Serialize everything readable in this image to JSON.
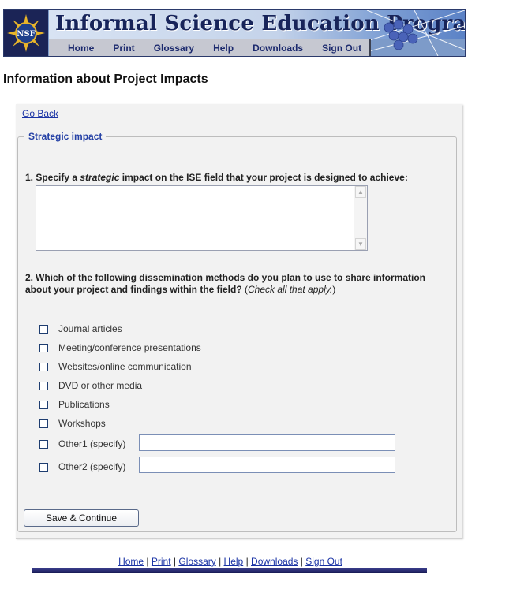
{
  "banner": {
    "title": "Informal Science Education Program",
    "logo_text": "NSF",
    "nav": [
      "Home",
      "Print",
      "Glossary",
      "Help",
      "Downloads",
      "Sign Out"
    ]
  },
  "page": {
    "heading": "Information about Project Impacts",
    "go_back": "Go Back"
  },
  "form": {
    "legend": "Strategic impact",
    "q1_prefix": "1. Specify a ",
    "q1_emph": "strategic",
    "q1_suffix": " impact on the ISE field that your project is designed to achieve:",
    "impact_value": "",
    "q2_num": "2.",
    "q2_text": "Which of the following dissemination methods do you plan to use to share information about your project and findings within the field?",
    "q2_note_open": "(",
    "q2_note_emph": "Check all that apply.",
    "q2_note_close": ")",
    "options": [
      "Journal articles",
      "Meeting/conference presentations",
      "Websites/online communication",
      "DVD or other media",
      "Publications",
      "Workshops",
      "Other1 (specify)",
      "Other2 (specify)"
    ],
    "other1_value": "",
    "other2_value": "",
    "save_label": "Save & Continue"
  },
  "footer": {
    "links": [
      "Home",
      "Print",
      "Glossary",
      "Help",
      "Downloads",
      "Sign Out"
    ],
    "separator": "|"
  },
  "colors": {
    "link": "#1a33a5",
    "legend": "#2440a5",
    "banner_dark": "#17245a"
  }
}
